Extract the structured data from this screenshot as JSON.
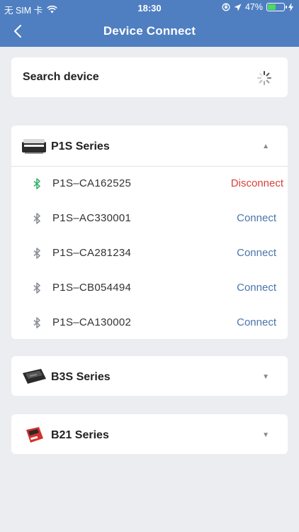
{
  "status_bar": {
    "carrier": "无 SIM 卡",
    "time": "18:30",
    "battery": "47%"
  },
  "nav": {
    "title": "Device Connect"
  },
  "search": {
    "label": "Search device"
  },
  "series": [
    {
      "name": "P1S Series",
      "expanded": true,
      "devices": [
        {
          "name": "P1S–CA162525",
          "action": "Disconnect",
          "connected": true
        },
        {
          "name": "P1S–AC330001",
          "action": "Connect",
          "connected": false
        },
        {
          "name": "P1S–CA281234",
          "action": "Connect",
          "connected": false
        },
        {
          "name": "P1S–CB054494",
          "action": "Connect",
          "connected": false
        },
        {
          "name": "P1S–CA130002",
          "action": "Connect",
          "connected": false
        }
      ]
    },
    {
      "name": "B3S Series",
      "expanded": false,
      "devices": []
    },
    {
      "name": "B21 Series",
      "expanded": false,
      "devices": []
    }
  ],
  "colors": {
    "header": "#4f7fc1",
    "connect": "#4a74ad",
    "disconnect": "#d9413b",
    "bt_active": "#3cb371",
    "bt_inactive": "#8a8f98"
  }
}
